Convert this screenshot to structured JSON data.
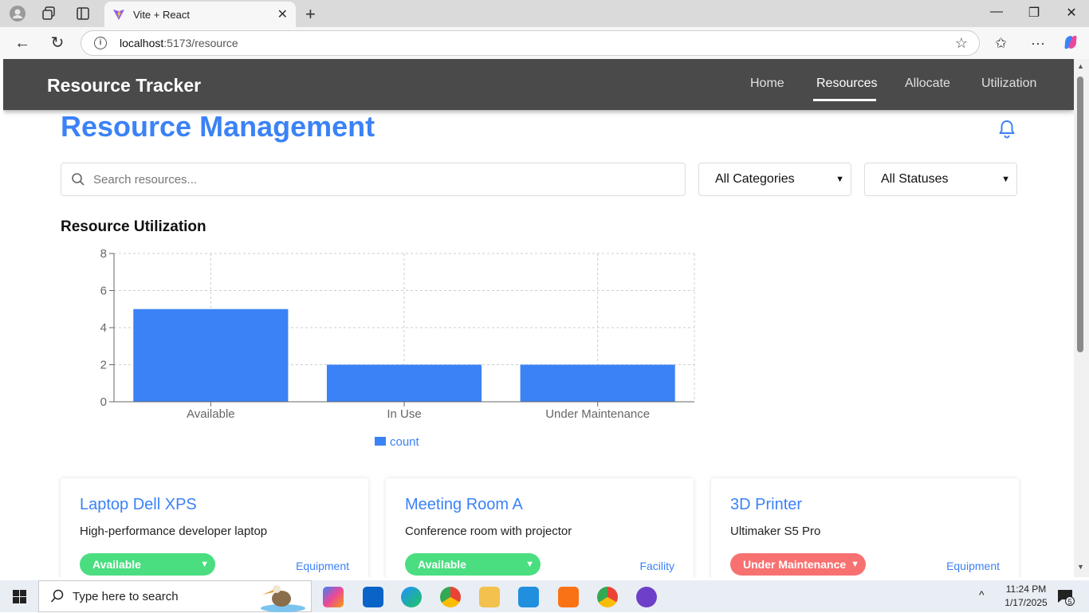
{
  "browser": {
    "tab_title": "Vite + React",
    "url_host": "localhost",
    "url_path": ":5173/resource"
  },
  "nav": {
    "brand": "Resource Tracker",
    "links": [
      "Home",
      "Resources",
      "Allocate",
      "Utilization"
    ],
    "active": "Resources"
  },
  "page": {
    "title": "Resource Management",
    "search_placeholder": "Search resources...",
    "category_filter": "All Categories",
    "status_filter": "All Statuses",
    "section_heading": "Resource Utilization"
  },
  "chart_data": {
    "type": "bar",
    "categories": [
      "Available",
      "In Use",
      "Under Maintenance"
    ],
    "series": [
      {
        "name": "count",
        "values": [
          5,
          2,
          2
        ]
      }
    ],
    "ylim": [
      0,
      8
    ],
    "yticks": [
      0,
      2,
      4,
      6,
      8
    ],
    "grid": true,
    "legend": "bottom",
    "color": "#3b82f6"
  },
  "resources": [
    {
      "name": "Laptop Dell XPS",
      "description": "High-performance developer laptop",
      "status": "Available",
      "status_color": "#4ade80",
      "category": "Equipment"
    },
    {
      "name": "Meeting Room A",
      "description": "Conference room with projector",
      "status": "Available",
      "status_color": "#4ade80",
      "category": "Facility"
    },
    {
      "name": "3D Printer",
      "description": "Ultimaker S5 Pro",
      "status": "Under Maintenance",
      "status_color": "#f87171",
      "category": "Equipment"
    }
  ],
  "taskbar": {
    "search_placeholder": "Type here to search",
    "time": "11:24 PM",
    "date": "1/17/2025",
    "notification_count": "5"
  }
}
